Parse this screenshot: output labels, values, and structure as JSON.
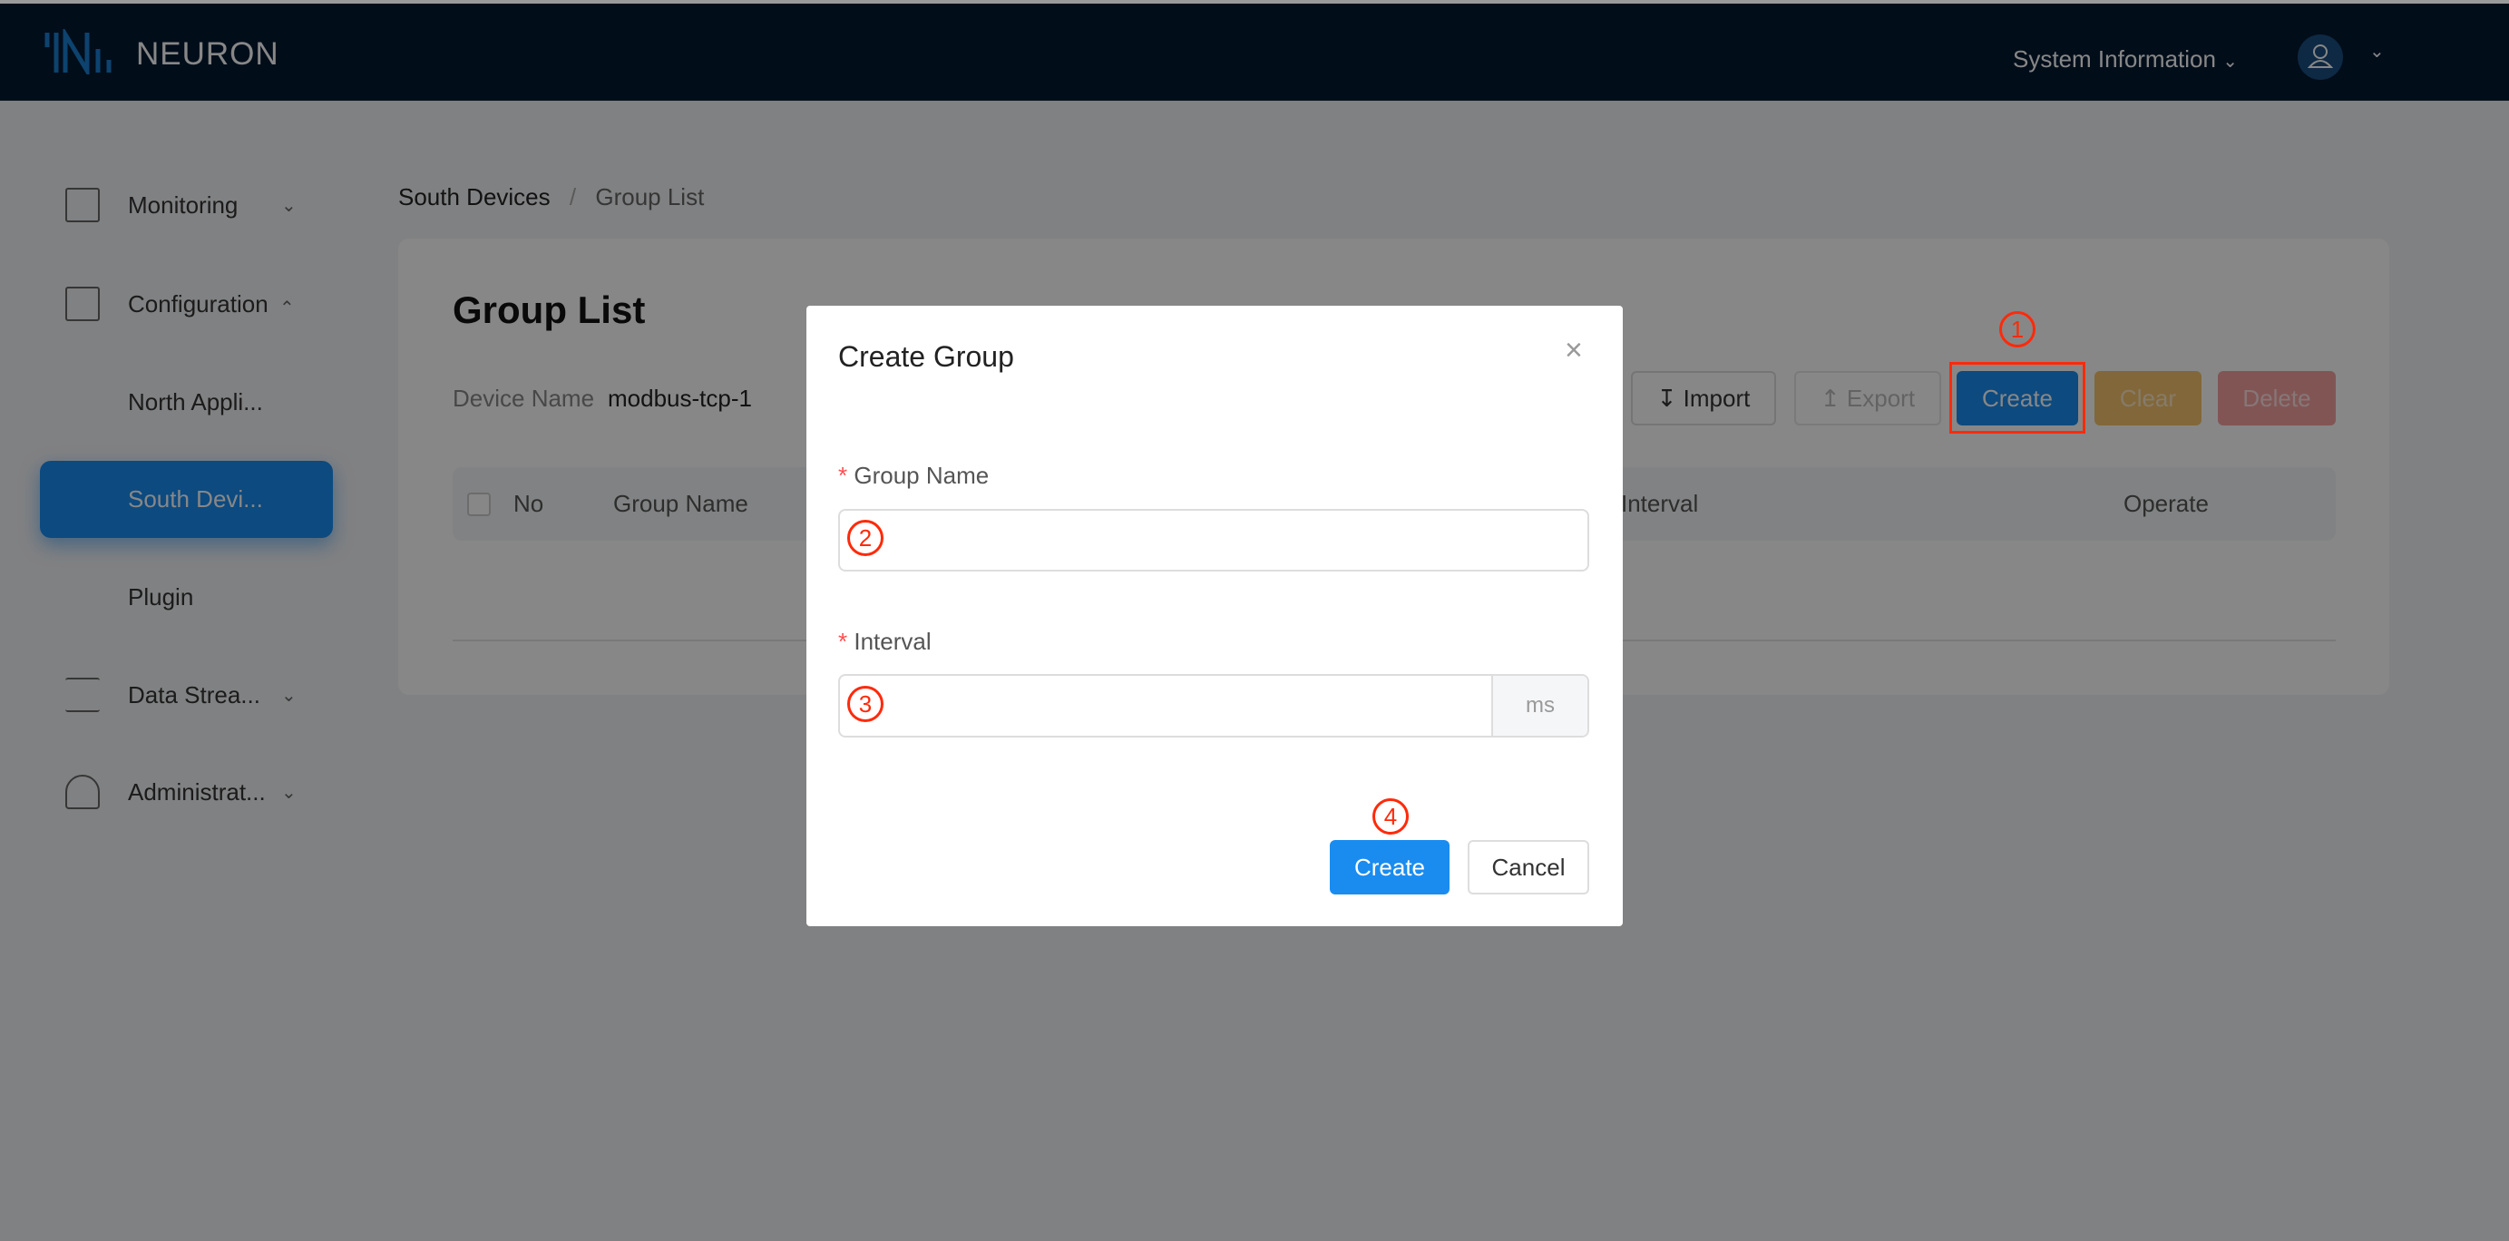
{
  "header": {
    "brand": "NEURON",
    "system_information": "System Information"
  },
  "sidebar": {
    "items": [
      {
        "label": "Monitoring"
      },
      {
        "label": "Configuration"
      },
      {
        "label": "North Appli..."
      },
      {
        "label": "South Devi..."
      },
      {
        "label": "Plugin"
      },
      {
        "label": "Data Strea..."
      },
      {
        "label": "Administrat..."
      }
    ]
  },
  "breadcrumb": {
    "parent": "South Devices",
    "separator": "/",
    "current": "Group List"
  },
  "page": {
    "title": "Group List",
    "device_name_label": "Device Name",
    "device_name_value": "modbus-tcp-1",
    "buttons": {
      "import": "Import",
      "export": "Export",
      "create": "Create",
      "clear": "Clear",
      "delete": "Delete"
    },
    "table_headers": [
      "No",
      "Group Name",
      "Interval",
      "Operate"
    ]
  },
  "modal": {
    "title": "Create Group",
    "group_name_label": "Group Name",
    "group_name_value": "",
    "interval_label": "Interval",
    "interval_value": "",
    "interval_unit": "ms",
    "required_mark": "*",
    "create": "Create",
    "cancel": "Cancel"
  },
  "annotations": [
    "1",
    "2",
    "3",
    "4"
  ],
  "colors": {
    "header_bg": "#041a32",
    "primary": "#1a8cf0",
    "clear": "#f0a925",
    "delete": "#f05050",
    "annotation": "#ff2a0a"
  }
}
